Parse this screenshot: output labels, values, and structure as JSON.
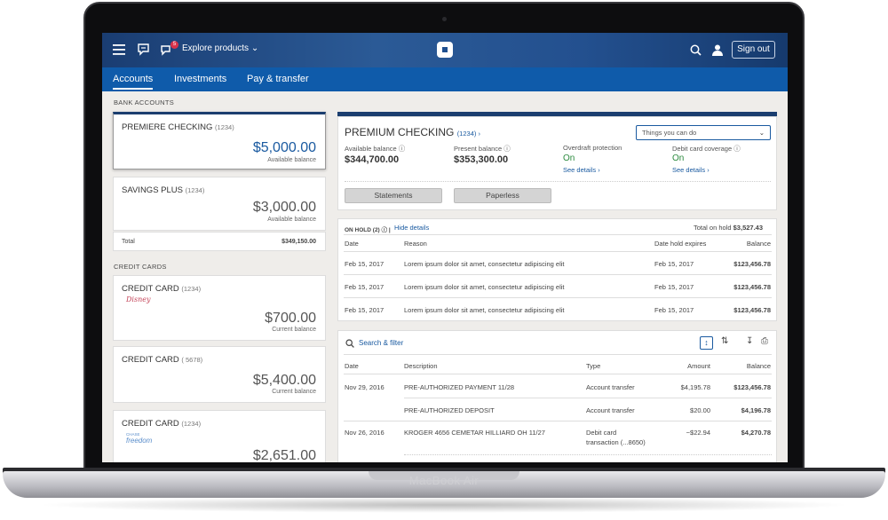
{
  "device": {
    "brand": "MacBook Air"
  },
  "topbar": {
    "explore_label": "Explore products",
    "notification_count": "5",
    "sign_out": "Sign out"
  },
  "nav": {
    "tabs": [
      {
        "label": "Accounts"
      },
      {
        "label": "Investments"
      },
      {
        "label": "Pay & transfer"
      }
    ]
  },
  "left": {
    "bank_label": "BANK ACCOUNTS",
    "bank_accounts": [
      {
        "name": "PREMIERE CHECKING",
        "num": "(1234)",
        "amount": "$5,000.00",
        "sub": "Available balance"
      },
      {
        "name": "SAVINGS PLUS",
        "num": "(1234)",
        "amount": "$3,000.00",
        "sub": "Available balance"
      }
    ],
    "total_label": "Total",
    "total_value": "$349,150.00",
    "credit_label": "CREDIT CARDS",
    "credit_cards": [
      {
        "name": "CREDIT CARD",
        "num": "(1234)",
        "logo": "Disney",
        "amount": "$700.00",
        "sub": "Current balance"
      },
      {
        "name": "CREDIT CARD",
        "num": "( 5678)",
        "amount": "$5,400.00",
        "sub": "Current balance"
      },
      {
        "name": "CREDIT CARD",
        "num": "(1234)",
        "logo": "freedom",
        "logo_top": "CHASE",
        "amount": "$2,651.00"
      }
    ]
  },
  "summary": {
    "title": "PREMIUM CHECKING",
    "num": "(1234)",
    "things": "Things you can do",
    "available_label": "Available balance",
    "available_value": "$344,700.00",
    "present_label": "Present balance",
    "present_value": "$353,300.00",
    "overdraft_label": "Overdraft protection",
    "overdraft_value": "On",
    "debit_label": "Debit card coverage",
    "debit_value": "On",
    "see_details": "See details",
    "statements": "Statements",
    "paperless": "Paperless"
  },
  "hold": {
    "label": "ON HOLD (2)",
    "hide": "Hide details",
    "total_label": "Total on hold",
    "total_value": "$3,527.43",
    "headers": [
      "Date",
      "Reason",
      "Date hold expires",
      "Balance"
    ],
    "rows": [
      {
        "date": "Feb 15, 2017",
        "reason": "Lorem ipsum dolor sit amet, consectetur adipiscing elit",
        "expires": "Feb 15, 2017",
        "balance": "$123,456.78"
      },
      {
        "date": "Feb 15, 2017",
        "reason": "Lorem ipsum dolor sit amet, consectetur adipiscing elit",
        "expires": "Feb 15, 2017",
        "balance": "$123,456.78"
      },
      {
        "date": "Feb 15, 2017",
        "reason": "Lorem ipsum dolor sit amet, consectetur adipiscing elit",
        "expires": "Feb 15, 2017",
        "balance": "$123,456.78"
      }
    ]
  },
  "transactions": {
    "search": "Search & filter",
    "headers": [
      "Date",
      "Description",
      "Type",
      "Amount",
      "Balance"
    ],
    "rows": [
      {
        "date": "Nov 29, 2016",
        "desc": "PRE-AUTHORIZED PAYMENT 11/28",
        "type": "Account transfer",
        "type2": "",
        "amount": "$4,195.78",
        "balance": "$123,456.78"
      },
      {
        "date": "",
        "desc": "PRE-AUTHORIZED DEPOSIT",
        "type": "Account transfer",
        "type2": "",
        "amount": "$20.00",
        "balance": "$4,196.78"
      },
      {
        "date": "Nov 26, 2016",
        "desc": "KROGER 4656 CEMETAR HILLIARD OH 11/27",
        "type": "Debit card",
        "type2": "transaction (...8650)",
        "amount": "−$22.94",
        "balance": "$4,270.78"
      }
    ]
  }
}
